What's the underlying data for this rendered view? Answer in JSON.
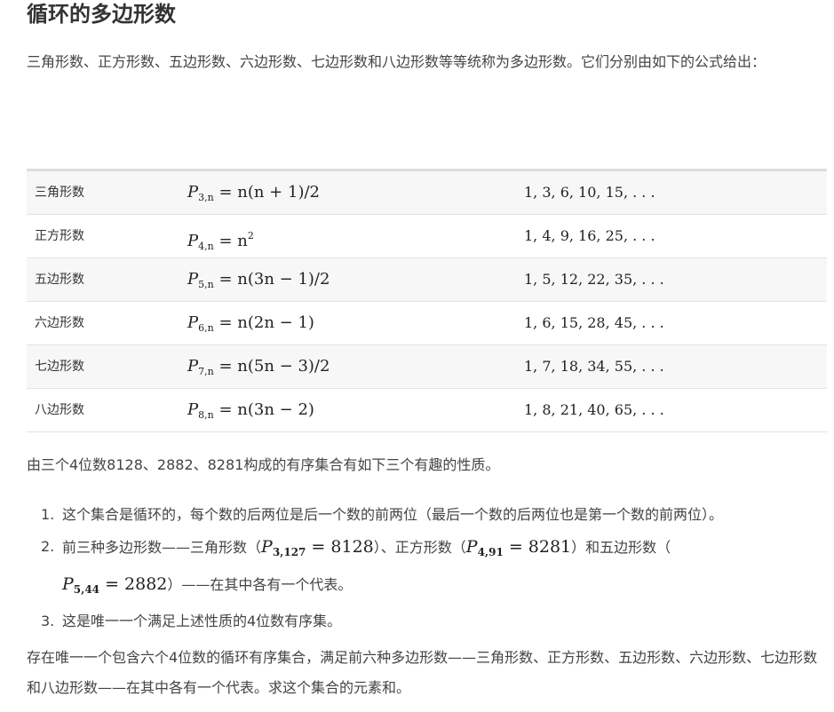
{
  "title": "循环的多边形数",
  "intro": "三角形数、正方形数、五边形数、六边形数、七边形数和八边形数等等统称为多边形数。它们分别由如下的公式给出：",
  "table": {
    "rows": [
      {
        "name": "三角形数",
        "P": "P",
        "sub": "3,n",
        "formula": "= n(n + 1)/2",
        "sup": "",
        "sequence": "1, 3, 6, 10, 15, . . ."
      },
      {
        "name": "正方形数",
        "P": "P",
        "sub": "4,n",
        "formula": "= n",
        "sup": "2",
        "sequence": "1, 4, 9, 16, 25, . . ."
      },
      {
        "name": "五边形数",
        "P": "P",
        "sub": "5,n",
        "formula": "= n(3n − 1)/2",
        "sup": "",
        "sequence": "1, 5, 12, 22, 35, . . ."
      },
      {
        "name": "六边形数",
        "P": "P",
        "sub": "6,n",
        "formula": "= n(2n − 1)",
        "sup": "",
        "sequence": "1, 6, 15, 28, 45, . . ."
      },
      {
        "name": "七边形数",
        "P": "P",
        "sub": "7,n",
        "formula": "= n(5n − 3)/2",
        "sup": "",
        "sequence": "1, 7, 18, 34, 55, . . ."
      },
      {
        "name": "八边形数",
        "P": "P",
        "sub": "8,n",
        "formula": "= n(3n − 2)",
        "sup": "",
        "sequence": "1, 8, 21, 40, 65, . . ."
      }
    ]
  },
  "lead": "由三个4位数8128、2882、8281构成的有序集合有如下三个有趣的性质。",
  "list": {
    "item1": {
      "num": "1.",
      "text": "这个集合是循环的，每个数的后两位是后一个数的前两位（最后一个数的后两位也是第一个数的前两位）。"
    },
    "item2": {
      "num": "2.",
      "t1": "前三种多边形数——三角形数（",
      "m1_P": "P",
      "m1_sub": "3,127",
      "m1_rest": " = 8128",
      "t2": "）、正方形数（",
      "m2_P": "P",
      "m2_sub": "4,91",
      "m2_rest": " = 8281",
      "t3": "）和五边形数（",
      "m3_P": "P",
      "m3_sub": "5,44",
      "m3_rest": " = 2882",
      "t4": "）——在其中各有一个代表。"
    },
    "item3": {
      "num": "3.",
      "text": "这是唯一一个满足上述性质的4位数有序集。"
    }
  },
  "closing": "存在唯一一个包含六个4位数的循环有序集合，满足前六种多边形数——三角形数、正方形数、五边形数、六边形数、七边形数和八边形数——在其中各有一个代表。求这个集合的元素和。"
}
